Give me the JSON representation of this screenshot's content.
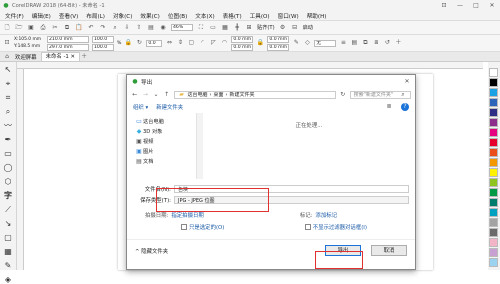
{
  "window": {
    "title": "CorelDRAW 2018 (64-Bit) - 未命名 -1",
    "controls": [
      "⊡",
      "—",
      "□",
      "✕"
    ]
  },
  "menu": [
    "文件(F)",
    "编辑(E)",
    "查看(V)",
    "布局(L)",
    "对象(C)",
    "效果(C)",
    "位图(B)",
    "文本(X)",
    "表格(T)",
    "工具(O)",
    "窗口(W)",
    "帮助(H)"
  ],
  "toolbar": {
    "zoom": "46%",
    "snap_label": "贴齐(T)",
    "launch_label": "启动"
  },
  "propbar": {
    "page_size": "A4",
    "width": "210.0 mm",
    "height": "297.0 mm",
    "scale_w": "100.0",
    "scale_h": "100.0",
    "pct": "%",
    "angle": "0.0",
    "pos_x_label": "X:",
    "pos_x": "105.0 mm",
    "pos_y_label": "Y:",
    "pos_y": "148.5 mm",
    "nudge1": "0.0 mm",
    "nudge2": "0.0 mm",
    "nudge3": "0.0 mm",
    "nudge4": "0.0 mm",
    "fill_none": "无"
  },
  "tabs": [
    "欢迎屏幕",
    "未命名 -1"
  ],
  "dialog": {
    "title": "导出",
    "close": "✕",
    "breadcrumb": [
      "这台电脑",
      "桌面",
      "新建文件夹"
    ],
    "search_placeholder": "搜索\"新建文件夹\"",
    "organize_label": "组织 ▾",
    "new_folder_label": "新建文件夹",
    "nav_items": [
      "这台电脑",
      "3D 对象",
      "视频",
      "图片",
      "文档"
    ],
    "working_text": "正在处理...",
    "filename_label": "文件名(N):",
    "filename_value": "色块",
    "filetype_label": "保存类型(T):",
    "filetype_value": "JPG - JPEG 位图",
    "shoot_date_label": "拍摄日期:",
    "shoot_date_value": "指定拍摄日期",
    "tags_label": "标记:",
    "tags_value": "添加标记",
    "check1": "只是选定的(O)",
    "check2": "不显示过滤器对话框(I)",
    "hide_folders": "隐藏文件夹",
    "export_btn": "导出",
    "cancel_btn": "取消"
  },
  "palette_colors": [
    "#ffffff",
    "#000000",
    "#1aa1e3",
    "#2b64b8",
    "#2f2f86",
    "#8c2f8c",
    "#e5007f",
    "#e6002d",
    "#e94e1b",
    "#f39800",
    "#fff100",
    "#8fc31f",
    "#009944",
    "#007c6c",
    "#00a0c0",
    "#a3a3a3",
    "#6b6b6b",
    "#f4b4c8",
    "#c8a0d2",
    "#9bd2f0"
  ]
}
